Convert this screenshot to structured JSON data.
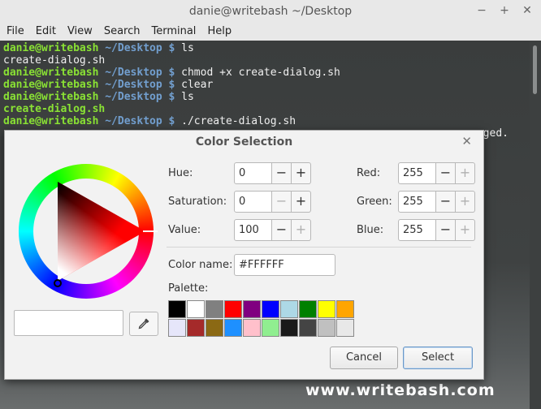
{
  "window": {
    "title": "danie@writebash ~/Desktop",
    "controls": [
      "−",
      "+",
      "✕"
    ]
  },
  "menu": [
    "File",
    "Edit",
    "View",
    "Search",
    "Terminal",
    "Help"
  ],
  "terminal": {
    "lines": [
      {
        "user": "danie@writebash",
        "path": " ~/Desktop $ ",
        "cmd": "ls"
      },
      {
        "out": "create-dialog.sh"
      },
      {
        "user": "danie@writebash",
        "path": " ~/Desktop $ ",
        "cmd": "chmod +x create-dialog.sh"
      },
      {
        "user": "danie@writebash",
        "path": " ~/Desktop $ ",
        "cmd": "clear"
      },
      {
        "user": "danie@writebash",
        "path": " ~/Desktop $ ",
        "cmd": "ls"
      },
      {
        "green": "create-dialog.sh"
      },
      {
        "user": "danie@writebash",
        "path": " ~/Desktop $ ",
        "cmd": "./create-dialog.sh"
      },
      {
        "tail": "nged."
      }
    ]
  },
  "watermark": "www.writebash.com",
  "dialog": {
    "title": "Color Selection",
    "close": "✕",
    "hsv": [
      {
        "label": "Hue:",
        "value": "0",
        "minus_enabled": true,
        "plus_enabled": true
      },
      {
        "label": "Saturation:",
        "value": "0",
        "minus_enabled": false,
        "plus_enabled": true
      },
      {
        "label": "Value:",
        "value": "100",
        "minus_enabled": true,
        "plus_enabled": false
      }
    ],
    "rgb": [
      {
        "label": "Red:",
        "value": "255",
        "minus_enabled": true,
        "plus_enabled": false
      },
      {
        "label": "Green:",
        "value": "255",
        "minus_enabled": true,
        "plus_enabled": false
      },
      {
        "label": "Blue:",
        "value": "255",
        "minus_enabled": true,
        "plus_enabled": false
      }
    ],
    "color_name_label": "Color name:",
    "color_name_value": "#FFFFFF",
    "palette_label": "Palette:",
    "palette": [
      "#000000",
      "#ffffff",
      "#808080",
      "#ff0000",
      "#800080",
      "#0000ff",
      "#add8e6",
      "#008000",
      "#ffff00",
      "#ffa500",
      "#e6e6fa",
      "#a52a2a",
      "#8b6914",
      "#1e90ff",
      "#ffc0cb",
      "#90ee90",
      "#1a1a1a",
      "#444444",
      "#c0c0c0",
      "#e8e8e8"
    ],
    "preview_color": "#ffffff",
    "cancel_label": "Cancel",
    "select_label": "Select"
  }
}
